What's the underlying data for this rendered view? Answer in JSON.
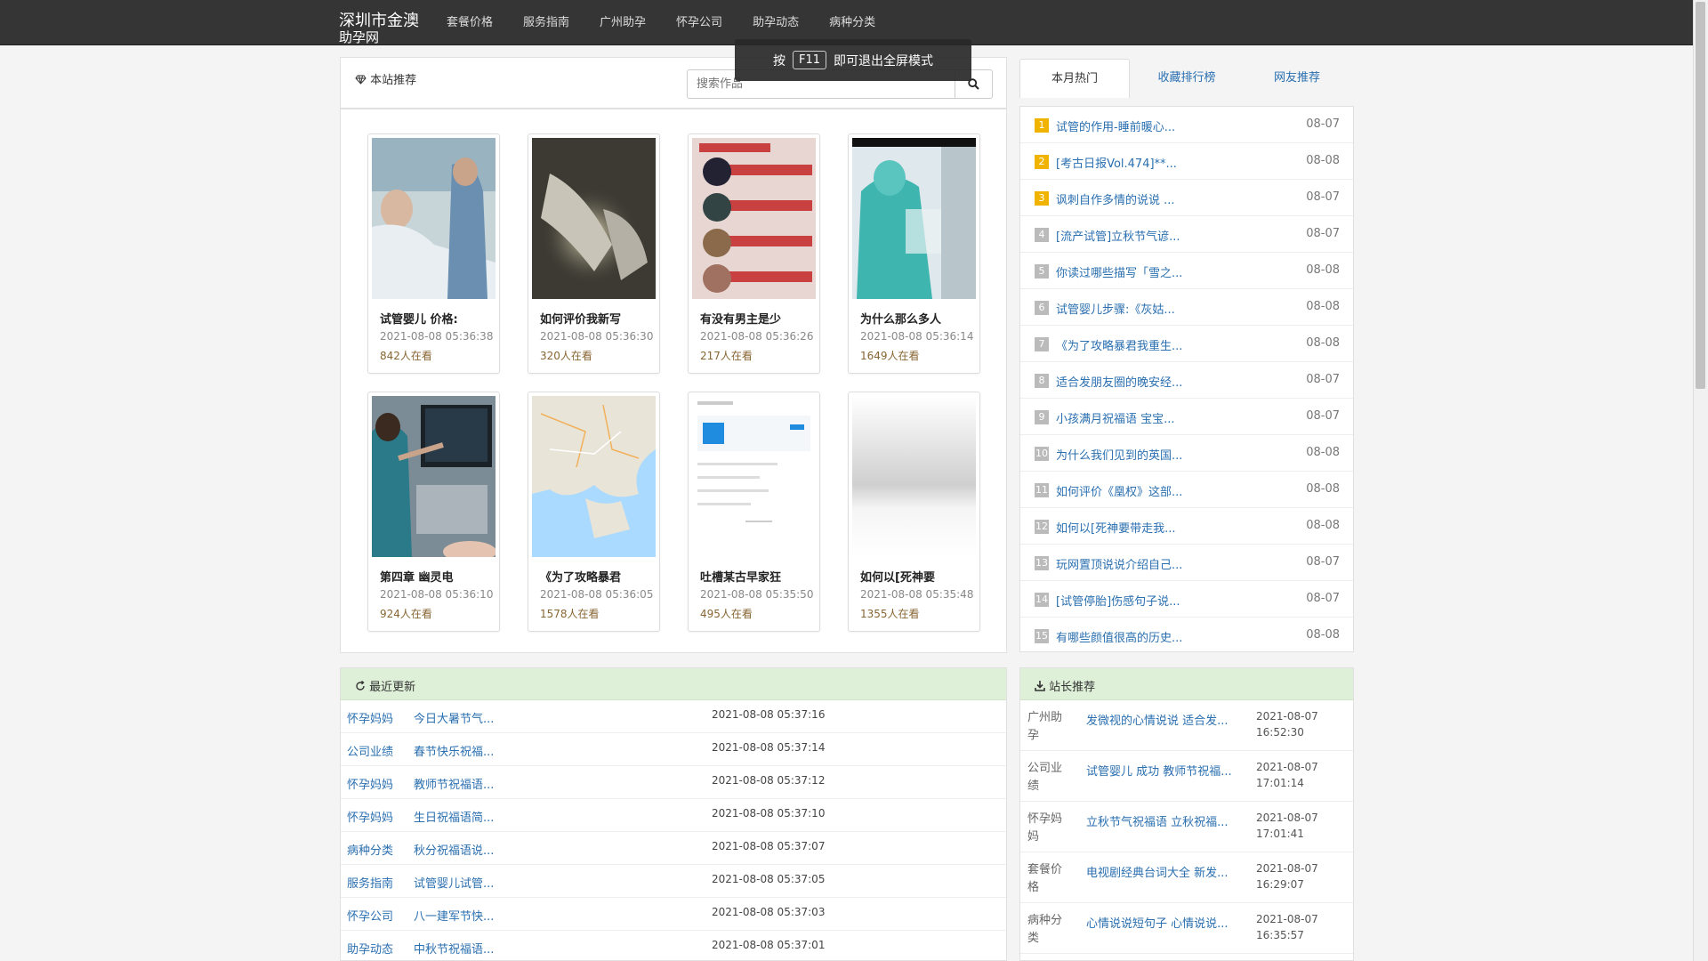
{
  "header": {
    "brand_line1": "深圳市金澳",
    "brand_line2": "助孕网",
    "nav": [
      "套餐价格",
      "服务指南",
      "广州助孕",
      "怀孕公司",
      "助孕动态",
      "病种分类"
    ]
  },
  "toast": {
    "prefix": "按",
    "key": "F11",
    "suffix": "即可退出全屏模式"
  },
  "recommend": {
    "title": "本站推荐",
    "search_placeholder": "搜索作品",
    "cards": [
      {
        "title": "试管婴儿 价格:",
        "date": "2021-08-08 05:36:38",
        "views": "842人在看"
      },
      {
        "title": "如何评价我新写",
        "date": "2021-08-08 05:36:30",
        "views": "320人在看"
      },
      {
        "title": "有没有男主是少",
        "date": "2021-08-08 05:36:26",
        "views": "217人在看"
      },
      {
        "title": "为什么那么多人",
        "date": "2021-08-08 05:36:14",
        "views": "1649人在看"
      },
      {
        "title": "第四章 幽灵电",
        "date": "2021-08-08 05:36:10",
        "views": "924人在看"
      },
      {
        "title": "《为了攻略暴君",
        "date": "2021-08-08 05:36:05",
        "views": "1578人在看"
      },
      {
        "title": "吐槽某古早家狂",
        "date": "2021-08-08 05:35:50",
        "views": "495人在看"
      },
      {
        "title": "如何以[死神要",
        "date": "2021-08-08 05:35:48",
        "views": "1355人在看"
      }
    ]
  },
  "hot": {
    "tabs": [
      "本月热门",
      "收藏排行榜",
      "网友推荐"
    ],
    "items": [
      {
        "n": "1",
        "text": "试管的作用-睡前暖心...",
        "date": "08-07"
      },
      {
        "n": "2",
        "text": "[考古日报Vol.474]**...",
        "date": "08-08"
      },
      {
        "n": "3",
        "text": "讽刺自作多情的说说 ...",
        "date": "08-07"
      },
      {
        "n": "4",
        "text": "[流产试管]立秋节气谚...",
        "date": "08-07"
      },
      {
        "n": "5",
        "text": "你读过哪些描写「雪之...",
        "date": "08-08"
      },
      {
        "n": "6",
        "text": "试管婴儿步骤:《灰姑...",
        "date": "08-08"
      },
      {
        "n": "7",
        "text": "《为了攻略暴君我重生...",
        "date": "08-08"
      },
      {
        "n": "8",
        "text": "适合发朋友圈的晚安经...",
        "date": "08-07"
      },
      {
        "n": "9",
        "text": "小孩满月祝福语 宝宝...",
        "date": "08-07"
      },
      {
        "n": "10",
        "text": "为什么我们见到的英国...",
        "date": "08-08"
      },
      {
        "n": "11",
        "text": "如何评价《凰权》这部...",
        "date": "08-08"
      },
      {
        "n": "12",
        "text": "如何以[死神要带走我...",
        "date": "08-08"
      },
      {
        "n": "13",
        "text": "玩网置顶说说介绍自己...",
        "date": "08-07"
      },
      {
        "n": "14",
        "text": "[试管停胎]伤感句子说...",
        "date": "08-07"
      },
      {
        "n": "15",
        "text": "有哪些颜值很高的历史...",
        "date": "08-08"
      }
    ]
  },
  "latest": {
    "title": "最近更新",
    "rows": [
      {
        "cat": "怀孕妈妈",
        "title": "今日大暑节气...",
        "date": "2021-08-08 05:37:16"
      },
      {
        "cat": "公司业绩",
        "title": "春节快乐祝福...",
        "date": "2021-08-08 05:37:14"
      },
      {
        "cat": "怀孕妈妈",
        "title": "教师节祝福语...",
        "date": "2021-08-08 05:37:12"
      },
      {
        "cat": "怀孕妈妈",
        "title": "生日祝福语简...",
        "date": "2021-08-08 05:37:10"
      },
      {
        "cat": "病种分类",
        "title": "秋分祝福语说...",
        "date": "2021-08-08 05:37:07"
      },
      {
        "cat": "服务指南",
        "title": "试管婴儿试管...",
        "date": "2021-08-08 05:37:05"
      },
      {
        "cat": "怀孕公司",
        "title": "八一建军节快...",
        "date": "2021-08-08 05:37:03"
      },
      {
        "cat": "助孕动态",
        "title": "中秋节祝福语...",
        "date": "2021-08-08 05:37:01"
      }
    ]
  },
  "picks": {
    "title": "站长推荐",
    "rows": [
      {
        "cat": "广州助孕",
        "title": "发微视的心情说说 适合发...",
        "date": "2021-08-07",
        "time": "16:52:30"
      },
      {
        "cat": "公司业绩",
        "title": "试管婴儿 成功 教师节祝福...",
        "date": "2021-08-07",
        "time": "17:01:14"
      },
      {
        "cat": "怀孕妈妈",
        "title": "立秋节气祝福语 立秋祝福...",
        "date": "2021-08-07",
        "time": "17:01:41"
      },
      {
        "cat": "套餐价格",
        "title": "电视剧经典台词大全 新发...",
        "date": "2021-08-07",
        "time": "16:29:07"
      },
      {
        "cat": "病种分类",
        "title": "心情说说短句子 心情说说...",
        "date": "2021-08-07",
        "time": "16:35:57"
      }
    ]
  }
}
